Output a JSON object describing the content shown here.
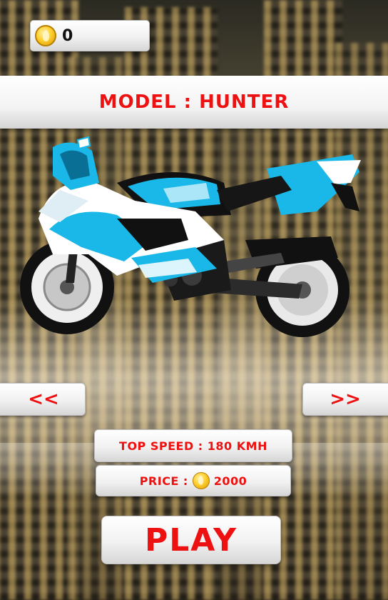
{
  "hud": {
    "coins": "0",
    "coin_icon": "gold-coin-icon"
  },
  "model": {
    "label": "MODEL : HUNTER"
  },
  "bike": {
    "icon": "sport-motorcycle",
    "colors": {
      "body": "#ffffff",
      "accent": "#1ab8e8",
      "dark": "#141414"
    }
  },
  "nav": {
    "prev_label": "<<",
    "next_label": ">>"
  },
  "stats": {
    "top_speed": "TOP SPEED : 180 KMH",
    "price_label": "PRICE",
    "price_separator": ":",
    "price_value": "2000"
  },
  "actions": {
    "play_label": "PLAY"
  },
  "colors": {
    "accent_red": "#ee1111",
    "button_white": "#f5f5f5"
  }
}
